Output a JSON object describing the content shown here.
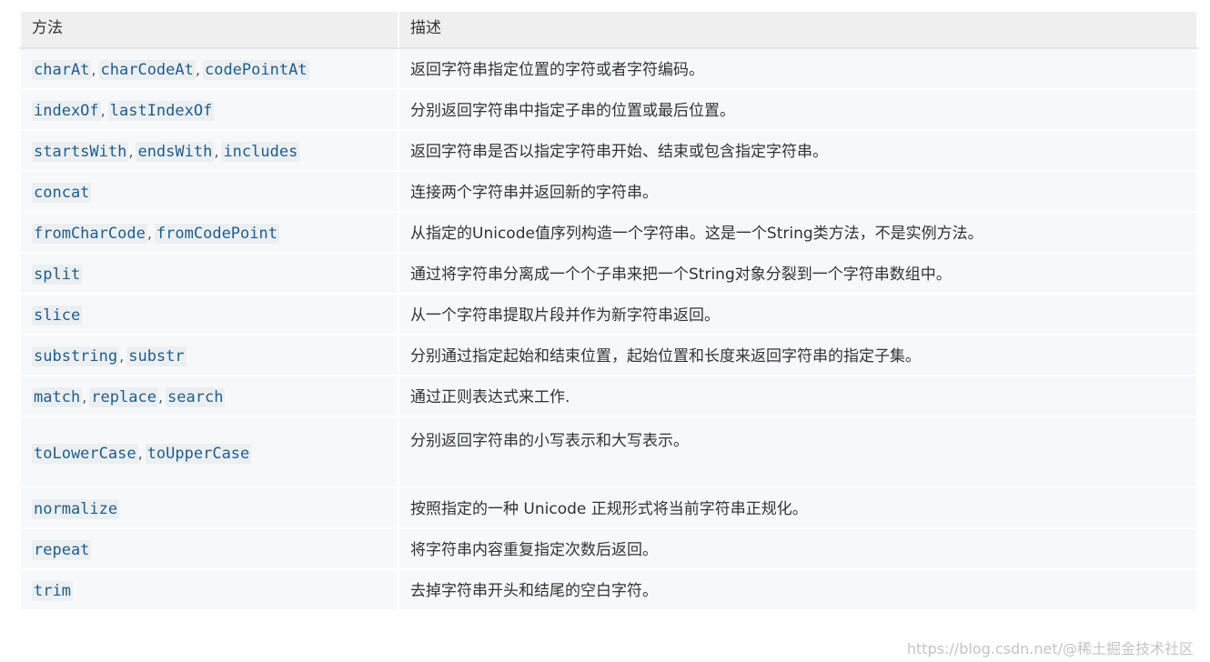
{
  "table": {
    "headers": [
      "方法",
      "描述"
    ],
    "rows": [
      {
        "methods": [
          "charAt",
          "charCodeAt",
          "codePointAt"
        ],
        "description": "返回字符串指定位置的字符或者字符编码。"
      },
      {
        "methods": [
          "indexOf",
          "lastIndexOf"
        ],
        "description": "分别返回字符串中指定子串的位置或最后位置。"
      },
      {
        "methods": [
          "startsWith",
          "endsWith",
          "includes"
        ],
        "description": "返回字符串是否以指定字符串开始、结束或包含指定字符串。"
      },
      {
        "methods": [
          "concat"
        ],
        "description": "连接两个字符串并返回新的字符串。"
      },
      {
        "methods": [
          "fromCharCode",
          "fromCodePoint"
        ],
        "description": "从指定的Unicode值序列构造一个字符串。这是一个String类方法，不是实例方法。"
      },
      {
        "methods": [
          "split"
        ],
        "description": "通过将字符串分离成一个个子串来把一个String对象分裂到一个字符串数组中。"
      },
      {
        "methods": [
          "slice"
        ],
        "description": "从一个字符串提取片段并作为新字符串返回。"
      },
      {
        "methods": [
          "substring",
          "substr"
        ],
        "description": "分别通过指定起始和结束位置，起始位置和长度来返回字符串的指定子集。"
      },
      {
        "methods": [
          "match",
          "replace",
          "search"
        ],
        "description": "通过正则表达式来工作."
      },
      {
        "methods": [
          "toLowerCase",
          "toUpperCase"
        ],
        "description": "分别返回字符串的小写表示和大写表示。",
        "tall": true
      },
      {
        "methods": [
          "normalize"
        ],
        "description": "按照指定的一种 Unicode 正规形式将当前字符串正规化。"
      },
      {
        "methods": [
          "repeat"
        ],
        "description": "将字符串内容重复指定次数后返回。"
      },
      {
        "methods": [
          "trim"
        ],
        "description": "去掉字符串开头和结尾的空白字符。"
      }
    ],
    "separator": ","
  },
  "watermark": "https://blog.csdn.net/@稀土掘金技术社区",
  "colors": {
    "header_bg": "#efefef",
    "row_bg": "#f7f8fa",
    "code_text": "#1f5d8a",
    "code_bg": "#eceff2",
    "text": "#333333"
  }
}
